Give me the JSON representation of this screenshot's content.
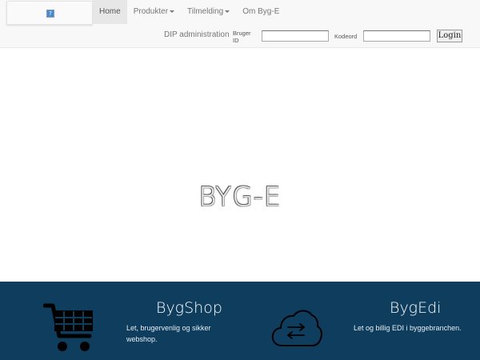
{
  "nav": {
    "items": [
      {
        "label": "Home",
        "active": true,
        "dropdown": false
      },
      {
        "label": "Produkter",
        "active": false,
        "dropdown": true
      },
      {
        "label": "Tilmelding",
        "active": false,
        "dropdown": true
      },
      {
        "label": "Om Byg-E",
        "active": false,
        "dropdown": false
      }
    ]
  },
  "login": {
    "admin_link": "DIP administration",
    "user_label": "Bruger ID",
    "user_value": "",
    "password_label": "Kodeord",
    "password_value": "",
    "button": "Login"
  },
  "hero": {
    "title": "BYG-E"
  },
  "features": {
    "shop": {
      "icon": "shopping-cart-icon",
      "title": "BygShop",
      "description": "Let, brugervenlig og sikker webshop."
    },
    "edi": {
      "icon": "cloud-exchange-icon",
      "title": "BygEdi",
      "description": "Let og billig EDI i byggebranchen."
    }
  },
  "colors": {
    "navbar_bg": "#f8f8f8",
    "footer_bg": "#0e3d5e",
    "icon_color": "#000000"
  }
}
